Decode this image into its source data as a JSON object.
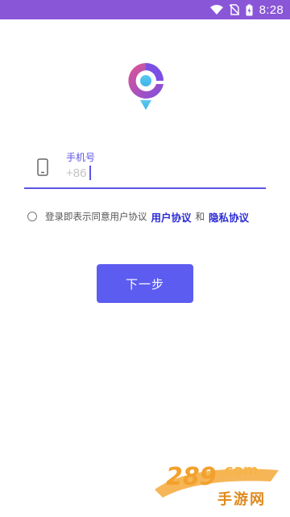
{
  "status_bar": {
    "time": "8:28",
    "icons": [
      "wifi-icon",
      "no-sim-icon",
      "battery-charging-icon"
    ],
    "color": "#8a56d8"
  },
  "logo": {
    "icon": "location-pin-logo-icon",
    "gradient": [
      "#e0558f",
      "#7b4fe3",
      "#47c6ee"
    ]
  },
  "login": {
    "phone_label": "手机号",
    "phone_placeholder": "+86",
    "phone_value": ""
  },
  "agreement": {
    "text": "登录即表示同意用户协议",
    "user_agreement_link": "用户协议",
    "and": "和",
    "privacy_link": "隐私协议",
    "checked": false
  },
  "next_button": {
    "label": "下一步",
    "color": "#5c5cf0"
  },
  "watermark": {
    "logo_text": "289.com",
    "text": "手游网"
  },
  "accent_color": "#5b55e6"
}
